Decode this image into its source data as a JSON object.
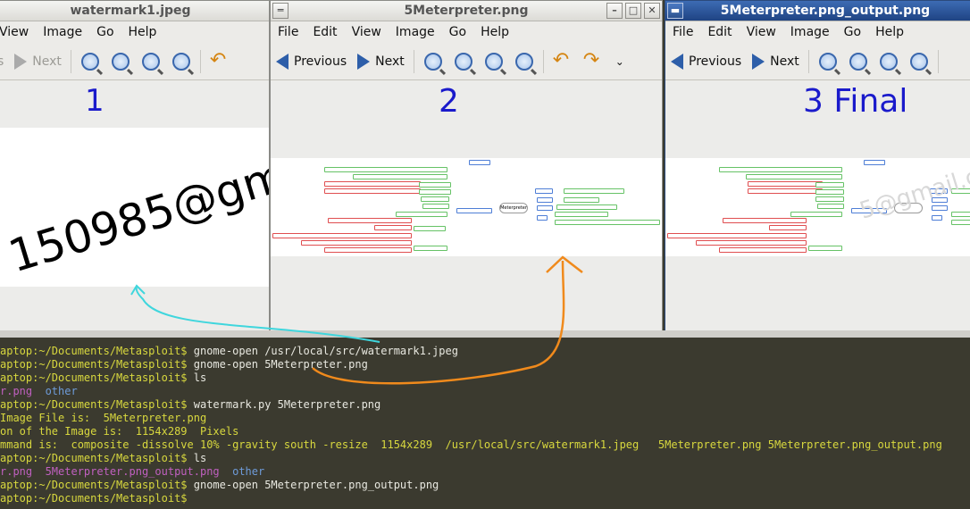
{
  "windows": [
    {
      "title": "watermark1.jpeg",
      "menu": [
        "View",
        "Image",
        "Go",
        "Help"
      ],
      "toolbar": {
        "prev_partial": "s",
        "next": "Next"
      },
      "overlay_label": "1",
      "watermark_text": "150985@gmail.co"
    },
    {
      "title": "5Meterpreter.png",
      "menu": [
        "File",
        "Edit",
        "View",
        "Image",
        "Go",
        "Help"
      ],
      "toolbar": {
        "previous": "Previous",
        "next": "Next"
      },
      "overlay_label": "2"
    },
    {
      "title": "5Meterpreter.png_output.png",
      "menu": [
        "File",
        "Edit",
        "View",
        "Image",
        "Go",
        "Help"
      ],
      "toolbar": {
        "previous": "Previous",
        "next": "Next"
      },
      "overlay_label": "3 Final",
      "watermark_text": "5@gmail.co"
    }
  ],
  "terminal": {
    "lines": [
      {
        "prompt": "aptop:~/Documents/Metasploit$",
        "text": " gnome-open /usr/local/src/watermark1.jpeg"
      },
      {
        "prompt": "aptop:~/Documents/Metasploit$",
        "text": " gnome-open 5Meterpreter.png"
      },
      {
        "prompt": "aptop:~/Documents/Metasploit$",
        "text": " ls"
      },
      {
        "files": [
          "r.png",
          "other"
        ]
      },
      {
        "prompt": "aptop:~/Documents/Metasploit$",
        "text": " watermark.py 5Meterpreter.png"
      },
      {
        "output": "Image File is:  5Meterpreter.png"
      },
      {
        "output": "on of the Image is:  1154x289  Pixels"
      },
      {
        "output": "mmand is:  composite -dissolve 10% -gravity south -resize  1154x289  /usr/local/src/watermark1.jpeg   5Meterpreter.png 5Meterpreter.png_output.png"
      },
      {
        "prompt": "aptop:~/Documents/Metasploit$",
        "text": " ls"
      },
      {
        "files": [
          "r.png",
          "5Meterpreter.png_output.png",
          "other"
        ]
      },
      {
        "prompt": "aptop:~/Documents/Metasploit$",
        "text": " gnome-open 5Meterpreter.png_output.png"
      },
      {
        "prompt": "aptop:~/Documents/Metasploit$",
        "text": ""
      }
    ]
  },
  "mindmap": {
    "center": "Meterpreter",
    "run_node": "RUN <script>",
    "left_nodes": [
      "To know if remote user is active or not",
      "To run a meterpreter script we need the RUN command",
      "hit run and <tab> twice to get them",
      "To know if the owned machine is a VM",
      "To get the system environment variable",
      "run checkvm",
      "run get_env",
      "sysinfo",
      "route",
      "run get_application_list",
      "To get lots of info about victim system",
      "data dumped to",
      "/.msf4/logs/scripts/scraper/192.168.1.17_20120623.415046462",
      "This also gives us lots of info about victim system",
      "Output in ~/.msf4/logs/scripts/winenum/",
      "run scraper",
      "run winenum"
    ],
    "right_nodes": [
      "idletime",
      "sysinfo",
      "getting system information",
      "getuid",
      "getting User ID",
      "getpid",
      "To see what PID we are running as",
      "ps",
      "To list all the processes",
      "Match the getpid # on ps to know what process"
    ]
  },
  "colors": {
    "label": "#1a1acb",
    "arrow_cyan": "#3fd6dd",
    "arrow_orange": "#f08a1c",
    "terminal_bg": "#3b3a2f",
    "prompt": "#d8d83e"
  }
}
